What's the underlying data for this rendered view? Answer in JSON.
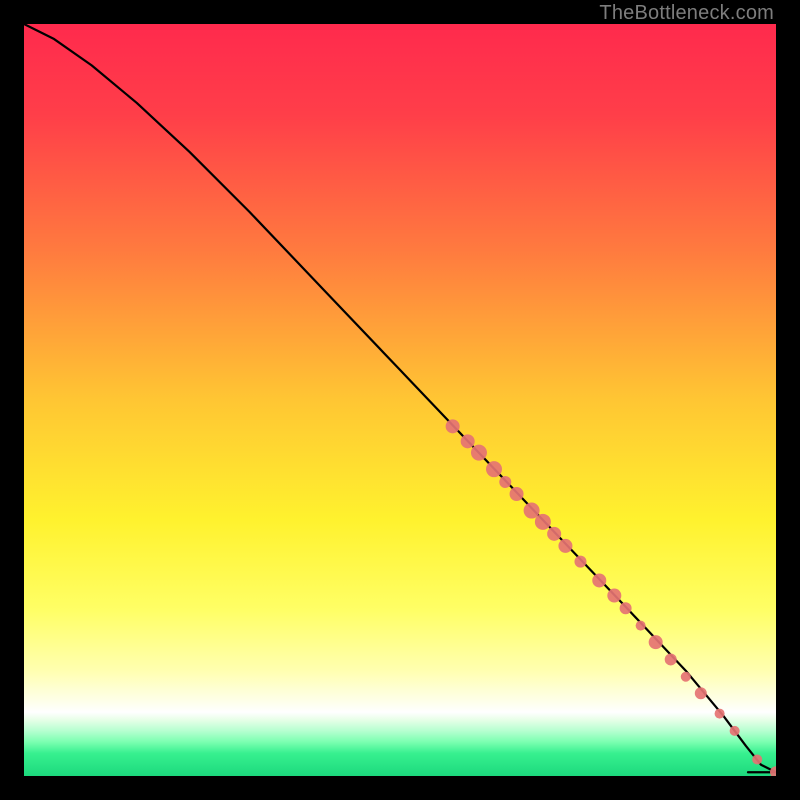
{
  "watermark": "TheBottleneck.com",
  "chart_data": {
    "type": "line",
    "title": "",
    "xlabel": "",
    "ylabel": "",
    "xlim": [
      0,
      100
    ],
    "ylim": [
      0,
      100
    ],
    "gradient_stops": [
      {
        "offset": 0.0,
        "color": "#ff2a4d"
      },
      {
        "offset": 0.12,
        "color": "#ff3e49"
      },
      {
        "offset": 0.3,
        "color": "#ff7a3f"
      },
      {
        "offset": 0.5,
        "color": "#ffc633"
      },
      {
        "offset": 0.66,
        "color": "#fff22e"
      },
      {
        "offset": 0.78,
        "color": "#ffff66"
      },
      {
        "offset": 0.86,
        "color": "#ffffb0"
      },
      {
        "offset": 0.905,
        "color": "#fefff0"
      },
      {
        "offset": 0.915,
        "color": "#ffffff"
      },
      {
        "offset": 0.925,
        "color": "#e8ffe8"
      },
      {
        "offset": 0.94,
        "color": "#b6ffd0"
      },
      {
        "offset": 0.955,
        "color": "#7affb0"
      },
      {
        "offset": 0.97,
        "color": "#37f08f"
      },
      {
        "offset": 1.0,
        "color": "#1cd97d"
      }
    ],
    "series": [
      {
        "name": "bottleneck-curve",
        "x": [
          0,
          4,
          9,
          15,
          22,
          30,
          40,
          50,
          60,
          70,
          80,
          88,
          93,
          96,
          98,
          100
        ],
        "y": [
          100,
          98,
          94.5,
          89.5,
          83,
          75,
          64.5,
          54,
          43.5,
          33,
          22.5,
          14,
          8,
          4,
          1.5,
          0.5
        ]
      }
    ],
    "markers": {
      "name": "highlight-points",
      "color": "#e57373",
      "points": [
        {
          "x": 57,
          "y": 46.5,
          "r": 7
        },
        {
          "x": 59,
          "y": 44.5,
          "r": 7
        },
        {
          "x": 60.5,
          "y": 43,
          "r": 8
        },
        {
          "x": 62.5,
          "y": 40.8,
          "r": 8
        },
        {
          "x": 64,
          "y": 39.1,
          "r": 6
        },
        {
          "x": 65.5,
          "y": 37.5,
          "r": 7
        },
        {
          "x": 67.5,
          "y": 35.3,
          "r": 8
        },
        {
          "x": 69,
          "y": 33.8,
          "r": 8
        },
        {
          "x": 70.5,
          "y": 32.2,
          "r": 7
        },
        {
          "x": 72,
          "y": 30.6,
          "r": 7
        },
        {
          "x": 74,
          "y": 28.5,
          "r": 6
        },
        {
          "x": 76.5,
          "y": 26,
          "r": 7
        },
        {
          "x": 78.5,
          "y": 24,
          "r": 7
        },
        {
          "x": 80,
          "y": 22.3,
          "r": 6
        },
        {
          "x": 82,
          "y": 20,
          "r": 5
        },
        {
          "x": 84,
          "y": 17.8,
          "r": 7
        },
        {
          "x": 86,
          "y": 15.5,
          "r": 6
        },
        {
          "x": 88,
          "y": 13.2,
          "r": 5
        },
        {
          "x": 90,
          "y": 11,
          "r": 6
        },
        {
          "x": 92.5,
          "y": 8.3,
          "r": 5
        },
        {
          "x": 94.5,
          "y": 6,
          "r": 5
        },
        {
          "x": 97.5,
          "y": 2.2,
          "r": 5
        },
        {
          "x": 100,
          "y": 0.5,
          "r": 6
        }
      ]
    }
  }
}
